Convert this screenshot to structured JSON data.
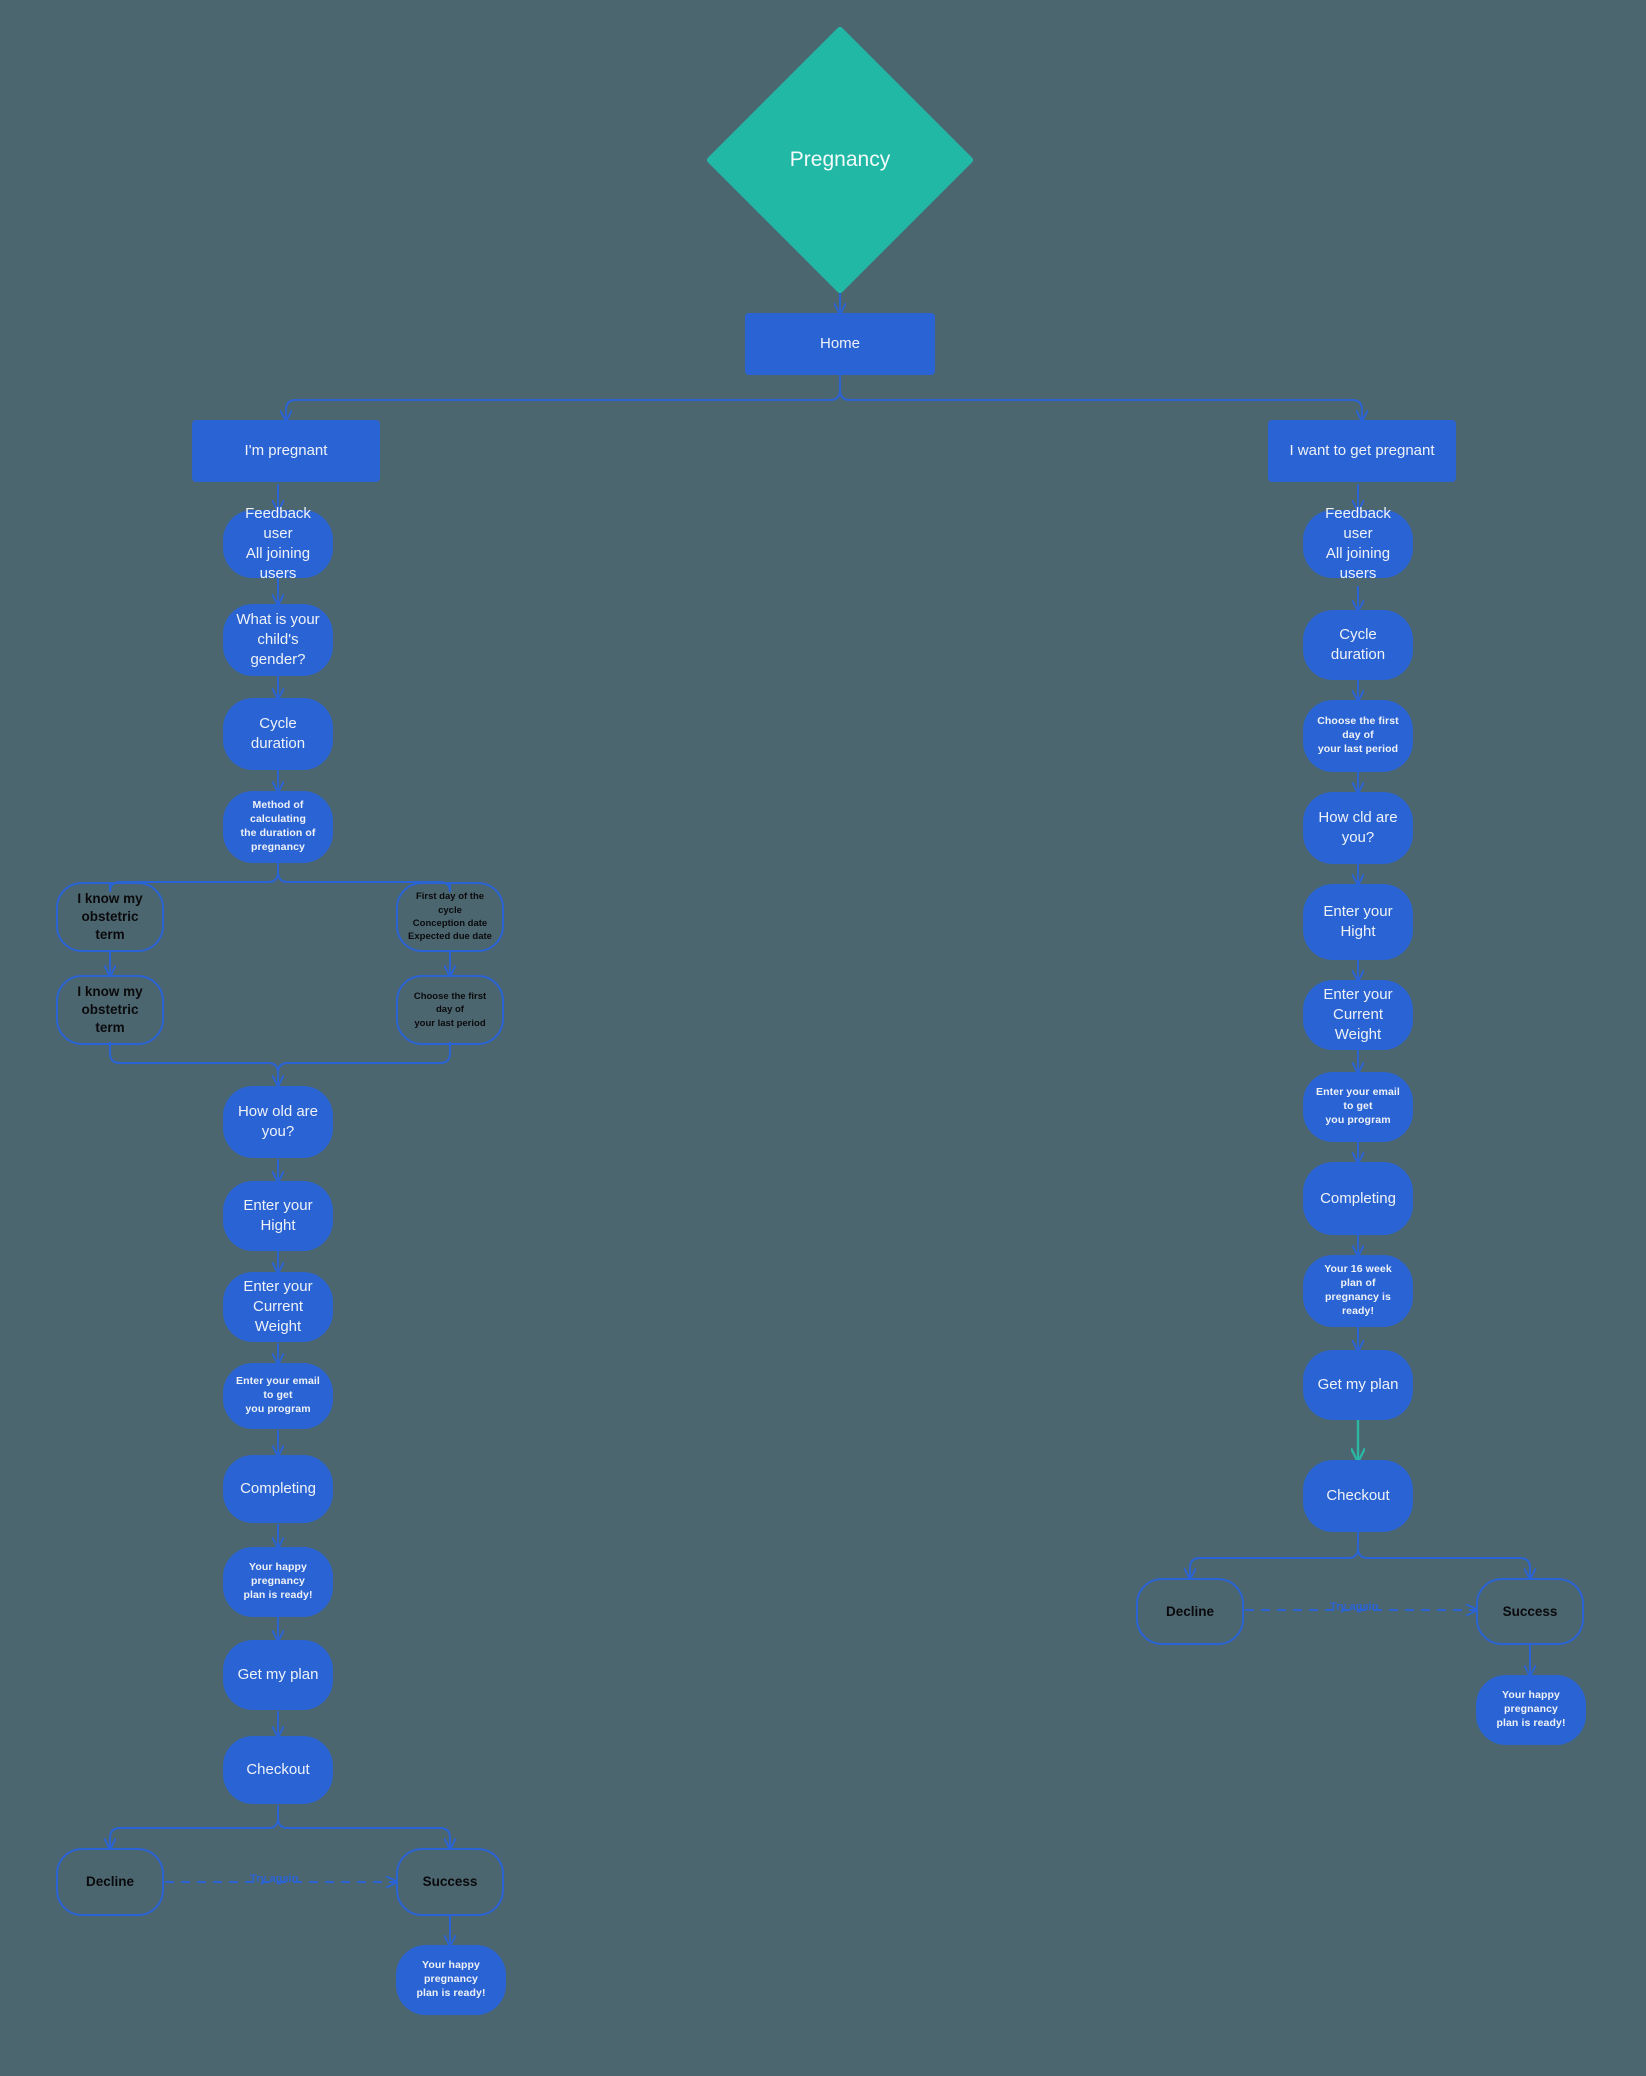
{
  "colors": {
    "background": "#4c6670",
    "node_fill": "#2a63d4",
    "node_stroke": "#2a63d4",
    "root_fill": "#22b8a6",
    "edge": "#2a63d4",
    "edge_accent": "#29b6a2",
    "text_light": "#eef2f7",
    "text_dark": "#0a0a0c"
  },
  "root": {
    "label": "Pregnancy"
  },
  "home": {
    "label": "Home"
  },
  "branches": {
    "left": {
      "label": "I'm pregnant"
    },
    "right": {
      "label": "I want to get pregnant"
    }
  },
  "left_flow": [
    {
      "id": "l-feedback",
      "label": "Feedback user\nAll joining users",
      "style": "screen"
    },
    {
      "id": "l-gender",
      "label": "What is your\nchild's gender?",
      "style": "screen"
    },
    {
      "id": "l-cycle",
      "label": "Cycle duration",
      "style": "screen"
    },
    {
      "id": "l-method",
      "label": "Method of calculating\nthe duration of\npregnancy",
      "style": "screen-small"
    },
    {
      "id": "l-obstetric1",
      "label": "I know my\nobstetric term",
      "style": "outline"
    },
    {
      "id": "l-firstday",
      "label": "First day of the cycle\nConception date\nExpected due date",
      "style": "outline-tiny"
    },
    {
      "id": "l-obstetric2",
      "label": "I know my\nobstetric term",
      "style": "outline"
    },
    {
      "id": "l-choosefd",
      "label": "Choose the first day of\nyour last period",
      "style": "outline-tiny"
    },
    {
      "id": "l-age",
      "label": "How old are\nyou?",
      "style": "screen"
    },
    {
      "id": "l-height",
      "label": "Enter your\nHight",
      "style": "screen"
    },
    {
      "id": "l-weight",
      "label": "Enter your\nCurrent Weight",
      "style": "screen"
    },
    {
      "id": "l-email",
      "label": "Enter your email to get\nyou program",
      "style": "screen-small"
    },
    {
      "id": "l-completing",
      "label": "Completing",
      "style": "screen"
    },
    {
      "id": "l-ready",
      "label": "Your happy pregnancy\nplan is ready!",
      "style": "screen-small"
    },
    {
      "id": "l-getplan",
      "label": "Get my plan",
      "style": "screen"
    },
    {
      "id": "l-checkout",
      "label": "Checkout",
      "style": "screen"
    },
    {
      "id": "l-decline",
      "label": "Decline",
      "style": "outline"
    },
    {
      "id": "l-success",
      "label": "Success",
      "style": "outline"
    },
    {
      "id": "l-final",
      "label": "Your happy pregnancy\nplan is ready!",
      "style": "screen-small"
    }
  ],
  "right_flow": [
    {
      "id": "r-feedback",
      "label": "Feedback user\nAll joining users",
      "style": "screen"
    },
    {
      "id": "r-cycle",
      "label": "Cycle duration",
      "style": "screen"
    },
    {
      "id": "r-choosefd",
      "label": "Choose the first day of\nyour last period",
      "style": "screen-small"
    },
    {
      "id": "r-age",
      "label": "How cld are\nyou?",
      "style": "screen"
    },
    {
      "id": "r-height",
      "label": "Enter your\nHight",
      "style": "screen"
    },
    {
      "id": "r-weight",
      "label": "Enter your\nCurrent Weight",
      "style": "screen"
    },
    {
      "id": "r-email",
      "label": "Enter your email to get\nyou program",
      "style": "screen-small"
    },
    {
      "id": "r-completing",
      "label": "Completing",
      "style": "screen"
    },
    {
      "id": "r-ready",
      "label": "Your 16 week plan of\npregnancy is ready!",
      "style": "screen-small"
    },
    {
      "id": "r-getplan",
      "label": "Get my plan",
      "style": "screen"
    },
    {
      "id": "r-checkout",
      "label": "Checkout",
      "style": "screen"
    },
    {
      "id": "r-decline",
      "label": "Decline",
      "style": "outline"
    },
    {
      "id": "r-success",
      "label": "Success",
      "style": "outline"
    },
    {
      "id": "r-final",
      "label": "Your happy pregnancy\nplan is ready!",
      "style": "screen-small"
    }
  ],
  "edge_labels": {
    "left_try_again": "Try again",
    "right_try_again": "Try again"
  }
}
